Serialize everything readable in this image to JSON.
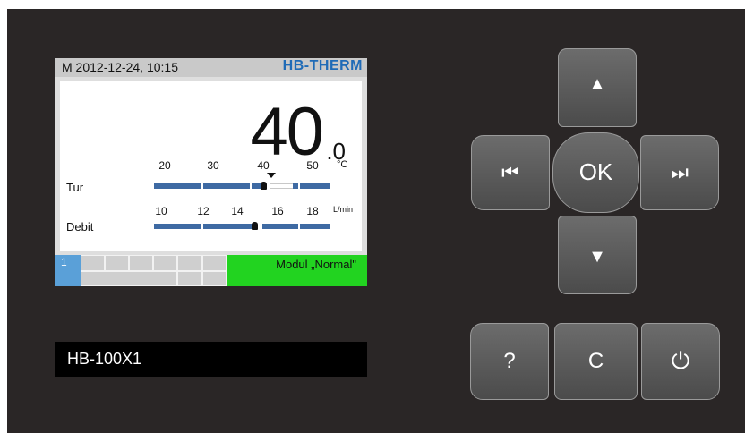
{
  "screen": {
    "datetime": "M 2012-12-24, 10:15",
    "brand": "HB-THERM",
    "big_value": "40",
    "big_decimal": ".0",
    "temp_row": {
      "label": "Tur",
      "unit": "°C",
      "ticks": [
        "20",
        "30",
        "40",
        "50"
      ],
      "actual": 40,
      "setpoint": 40
    },
    "flow_row": {
      "label": "Debit",
      "unit": "L/min",
      "ticks": [
        "10",
        "12",
        "14",
        "16",
        "18"
      ],
      "actual": 14.5
    },
    "footer": {
      "number": "1",
      "mode": "Modul „Normal\""
    }
  },
  "model_label": "HB-100X1",
  "buttons": {
    "up": "▲",
    "down": "▼",
    "prev": "⏮",
    "next": "⏭",
    "ok": "OK",
    "help": "?",
    "cancel": "C",
    "power": "⏻"
  }
}
